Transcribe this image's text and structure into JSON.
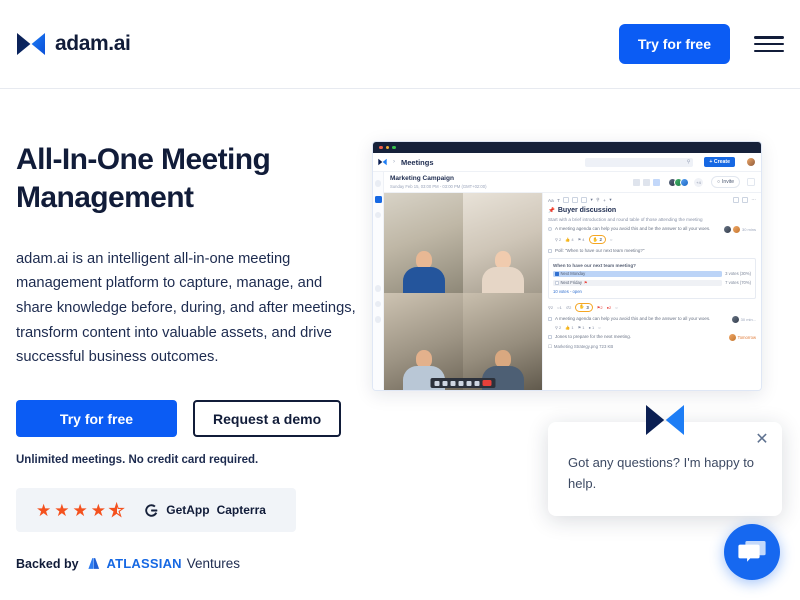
{
  "brand": {
    "name": "adam.ai",
    "accent": "#0b5cf4",
    "dark": "#111c39",
    "star_color": "#f4511e"
  },
  "header": {
    "logo_text": "adam.ai",
    "logo_icon": "adam-butterfly-logo-icon",
    "cta_label": "Try for free",
    "menu_icon": "hamburger-menu-icon"
  },
  "hero": {
    "title": "All-In-One Meeting Management",
    "description": "adam.ai is an intelligent all-in-one meeting management platform to capture, manage, and share knowledge before, during, and after meetings, transform content into valuable assets, and drive successful business outcomes.",
    "primary_cta": "Try for free",
    "secondary_cta": "Request a demo",
    "fineprint": "Unlimited meetings. No credit card required.",
    "rating": {
      "stars_filled": 4,
      "has_half_star": true,
      "rating_value": 4.5,
      "getapp_label": "GetApp",
      "capterra_label": "Capterra",
      "getapp_icon": "getapp-g-icon"
    },
    "backed_by": {
      "prefix": "Backed by",
      "company": "ATLASSIAN",
      "suffix": "Ventures",
      "logo_icon": "atlassian-triangle-icon",
      "company_color": "#1668e3"
    }
  },
  "app_mock": {
    "window_dots": [
      "red",
      "yellow",
      "green"
    ],
    "topbar": {
      "logo_icon": "adam-butterfly-logo-icon",
      "breadcrumb_chevron": "chevron-right-icon",
      "title": "Meetings",
      "search_placeholder": "",
      "search_icon": "search-icon",
      "create_label": "+ Create",
      "avatar": "user-avatar"
    },
    "rail": {
      "items": [
        "rail-icon-1",
        "rail-icon-active-calendar",
        "rail-icon-3",
        "rail-icon-4",
        "rail-icon-5",
        "rail-icon-6"
      ]
    },
    "meeting_header": {
      "name": "Marketing Campaign",
      "date": "Sunday Feb 15, 03:00 PM - 03:00 PM (GMT+02:00)",
      "view_icons": [
        "grid-view-icon",
        "split-view-icon",
        "panel-view-icon"
      ],
      "attendee_overflow": "+4",
      "invite_label": "Invite",
      "invite_icon": "person-add-icon",
      "chat_icon": "comment-icon"
    },
    "video": {
      "participants": [
        "participant-1",
        "participant-2",
        "participant-3",
        "participant-4"
      ],
      "controls": [
        "mic-icon",
        "camera-icon",
        "screen-share-icon",
        "record-icon",
        "pause-icon",
        "more-icon"
      ],
      "end_call_icon": "end-call-icon"
    },
    "panel": {
      "toolbar_items": [
        "Aa",
        "T",
        "table-icon",
        "checkbox-icon",
        "image-icon",
        "poll-icon",
        "attach-icon",
        "plus-icon",
        "chevron-down-icon",
        "assign-icon",
        "lock-icon",
        "more-icon"
      ],
      "heading": "Buyer discussion",
      "heading_emoji": "pin-icon",
      "subtext": "Start with a brief introduction and round table of those attending the meeting",
      "items": [
        {
          "type": "radio",
          "text": "A meeting agenda can help you avoid this and be the answer to all your woes.",
          "time": "30 mins",
          "reactions": [
            "2",
            "4",
            "4"
          ],
          "highlight_count": "2"
        },
        {
          "type": "poll",
          "label": "Poll: \"When to have our next team meeting?\"",
          "question": "When to have our next team meeting?",
          "options": [
            {
              "label": "Next Monday",
              "votes": "3 votes (30%)",
              "selected": true
            },
            {
              "label": "Next Friday",
              "votes": "7 votes (70%)",
              "selected": false
            }
          ],
          "footer": "10 votes - open",
          "reactions": [
            "2",
            "1",
            "2",
            "2",
            "2"
          ],
          "highlight_count": "3"
        },
        {
          "type": "checkbox",
          "text": "A meeting agenda can help you avoid this and be the answer to all your woes.",
          "time": "30 min...",
          "reactions": [
            "2",
            "1",
            "1",
            "1"
          ]
        },
        {
          "type": "checkbox",
          "text": "Jones to prepare for the next meeting.",
          "due": "Tomorrow"
        }
      ],
      "attachment": "Marketing Strategy.png  723 KB"
    }
  },
  "chat_widget": {
    "message": "Got any questions? I'm happy to help.",
    "close_icon": "close-icon",
    "logo_icon": "adam-butterfly-logo-icon",
    "launcher_icon": "chat-bubbles-icon",
    "launcher_color": "#1668f0"
  }
}
